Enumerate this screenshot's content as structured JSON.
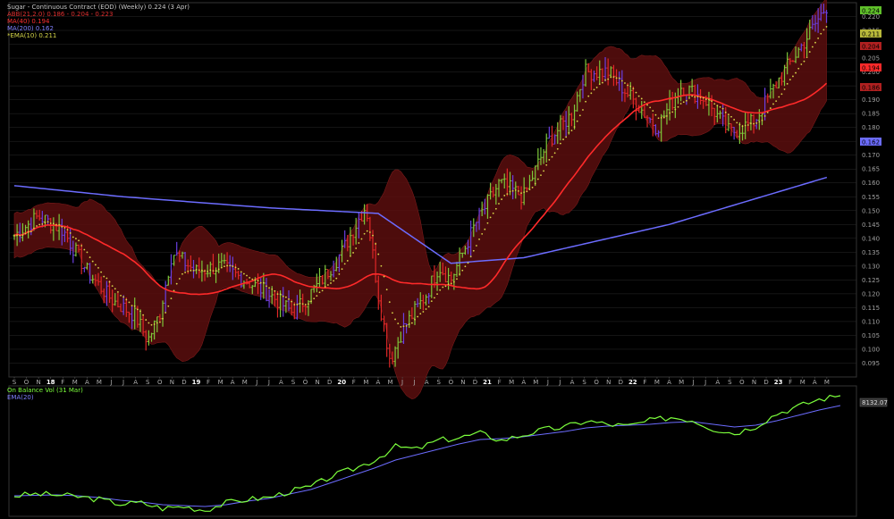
{
  "legend": {
    "title": "Sugar - Continuous Contract (EOD) (Weekly) 0.224 (3 Apr)",
    "bb": "ABB(21,2.0) 0.186 - 0.204 - 0.223",
    "ma40": "MA(40) 0.194",
    "ma200": "MA(200) 0.162",
    "ema10": "*EMA(10) 0.211",
    "obv": "On Balance Vol (31 Mar)",
    "obv_ema": "EMA(20)"
  },
  "colors": {
    "background": "#000000",
    "bars_up": "#7ec83a",
    "bars_down": "#e02828",
    "bars_other": "#6a3fe0",
    "band_fill": "#5a0e0e",
    "ma40": "#ff2a2a",
    "ma200": "#6c6cff",
    "ema10": "#d8d84a",
    "obv": "#7cff3c",
    "obv_ema": "#6c6cff",
    "grid": "#2a2a2a"
  },
  "chart_data": [
    {
      "type": "line",
      "title": "Sugar - Continuous Contract (EOD) (Weekly)",
      "last_value": "0.224",
      "last_date": "3 Apr",
      "ylim": [
        0.09,
        0.225
      ],
      "y_ticks": [
        "0.095",
        "0.100",
        "0.105",
        "0.110",
        "0.115",
        "0.120",
        "0.125",
        "0.130",
        "0.135",
        "0.140",
        "0.145",
        "0.150",
        "0.155",
        "0.160",
        "0.165",
        "0.170",
        "0.175",
        "0.180",
        "0.185",
        "0.190",
        "0.195",
        "0.200",
        "0.205",
        "0.210",
        "0.215",
        "0.220"
      ],
      "x_month_labels": [
        "S",
        "O",
        "N",
        "18",
        "F",
        "M",
        "A",
        "M",
        "J",
        "J",
        "A",
        "S",
        "O",
        "N",
        "D",
        "19",
        "F",
        "M",
        "A",
        "M",
        "J",
        "J",
        "A",
        "S",
        "O",
        "N",
        "D",
        "20",
        "F",
        "M",
        "A",
        "M",
        "J",
        "J",
        "A",
        "S",
        "O",
        "N",
        "D",
        "21",
        "F",
        "M",
        "A",
        "M",
        "J",
        "J",
        "A",
        "S",
        "O",
        "N",
        "D",
        "22",
        "F",
        "M",
        "A",
        "M",
        "J",
        "J",
        "A",
        "S",
        "O",
        "N",
        "D",
        "23",
        "F",
        "M",
        "A",
        "M"
      ],
      "right_tags": [
        {
          "label": "0.224",
          "color": "#5fbf2a"
        },
        {
          "label": "0.211",
          "color": "#b8b83a"
        },
        {
          "label": "0.204",
          "color": "#b02020"
        },
        {
          "label": "0.194",
          "color": "#ff2a2a"
        },
        {
          "label": "0.186",
          "color": "#b02020"
        },
        {
          "label": "0.162",
          "color": "#6c6cff"
        }
      ],
      "price_keypoints": [
        {
          "date": "2017-09",
          "close": 0.141
        },
        {
          "date": "2017-11",
          "close": 0.148
        },
        {
          "date": "2018-01",
          "close": 0.143
        },
        {
          "date": "2018-03",
          "close": 0.128
        },
        {
          "date": "2018-05",
          "close": 0.118
        },
        {
          "date": "2018-07",
          "close": 0.112
        },
        {
          "date": "2018-08",
          "close": 0.103
        },
        {
          "date": "2018-09",
          "close": 0.113
        },
        {
          "date": "2018-10",
          "close": 0.135
        },
        {
          "date": "2018-12",
          "close": 0.128
        },
        {
          "date": "2019-02",
          "close": 0.13
        },
        {
          "date": "2019-04",
          "close": 0.125
        },
        {
          "date": "2019-06",
          "close": 0.12
        },
        {
          "date": "2019-08",
          "close": 0.113
        },
        {
          "date": "2019-10",
          "close": 0.123
        },
        {
          "date": "2019-12",
          "close": 0.135
        },
        {
          "date": "2020-02",
          "close": 0.152
        },
        {
          "date": "2020-03",
          "close": 0.12
        },
        {
          "date": "2020-04",
          "close": 0.096
        },
        {
          "date": "2020-05",
          "close": 0.107
        },
        {
          "date": "2020-07",
          "close": 0.12
        },
        {
          "date": "2020-08",
          "close": 0.13
        },
        {
          "date": "2020-09",
          "close": 0.125
        },
        {
          "date": "2020-11",
          "close": 0.145
        },
        {
          "date": "2021-01",
          "close": 0.16
        },
        {
          "date": "2021-03",
          "close": 0.155
        },
        {
          "date": "2021-05",
          "close": 0.175
        },
        {
          "date": "2021-07",
          "close": 0.185
        },
        {
          "date": "2021-08",
          "close": 0.2
        },
        {
          "date": "2021-10",
          "close": 0.2
        },
        {
          "date": "2021-12",
          "close": 0.19
        },
        {
          "date": "2022-02",
          "close": 0.18
        },
        {
          "date": "2022-04",
          "close": 0.195
        },
        {
          "date": "2022-06",
          "close": 0.19
        },
        {
          "date": "2022-08",
          "close": 0.178
        },
        {
          "date": "2022-10",
          "close": 0.182
        },
        {
          "date": "2022-12",
          "close": 0.197
        },
        {
          "date": "2023-02",
          "close": 0.21
        },
        {
          "date": "2023-04",
          "close": 0.224
        }
      ],
      "ma200_keypoints": [
        {
          "date": "2017-09",
          "value": 0.159
        },
        {
          "date": "2018-06",
          "value": 0.155
        },
        {
          "date": "2019-06",
          "value": 0.151
        },
        {
          "date": "2020-03",
          "value": 0.149
        },
        {
          "date": "2020-09",
          "value": 0.131
        },
        {
          "date": "2021-03",
          "value": 0.133
        },
        {
          "date": "2022-03",
          "value": 0.145
        },
        {
          "date": "2023-04",
          "value": 0.162
        }
      ]
    },
    {
      "type": "line",
      "title": "On Balance Vol (31 Mar)",
      "last_value": "8132.07",
      "series": [
        {
          "name": "On Balance Vol",
          "values": [
            0,
            2,
            1,
            -1,
            -4,
            -9,
            -8,
            -14,
            -12,
            -16,
            -8,
            -4,
            -2,
            5,
            10,
            22,
            30,
            40,
            55,
            52,
            62,
            65,
            70,
            62,
            68,
            74,
            77,
            84,
            80,
            78,
            84,
            88,
            85,
            75,
            70,
            78,
            92,
            100,
            108,
            112
          ]
        },
        {
          "name": "EMA(20)",
          "values": [
            0,
            0.5,
            1,
            0,
            -2,
            -5,
            -7,
            -10,
            -11,
            -12,
            -10,
            -6,
            -3,
            2,
            7,
            15,
            23,
            31,
            40,
            46,
            52,
            58,
            63,
            64,
            66,
            69,
            72,
            76,
            78,
            79,
            80,
            82,
            83,
            80,
            77,
            79,
            84,
            90,
            96,
            101
          ]
        }
      ]
    }
  ]
}
